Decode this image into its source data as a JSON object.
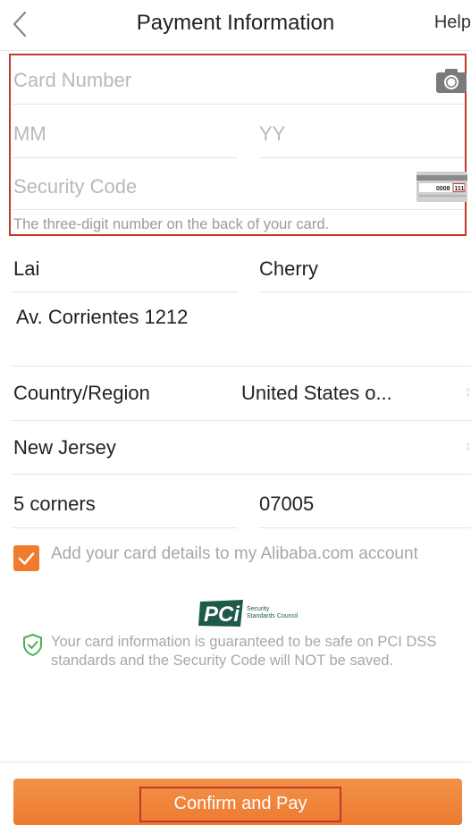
{
  "header": {
    "title": "Payment Information",
    "help_label": "Help"
  },
  "card": {
    "number_placeholder": "Card Number",
    "month_placeholder": "MM",
    "year_placeholder": "YY",
    "security_placeholder": "Security Code",
    "security_hint": "The three-digit number on the back of your card.",
    "card_image_number": "0008",
    "card_image_cvv": "111"
  },
  "billing": {
    "first_name": "Lai",
    "last_name": "Cherry",
    "address": "Av. Corrientes 1212",
    "country_label": "Country/Region",
    "country_value": "United States o...",
    "state": "New Jersey",
    "city": "5 corners",
    "zip": "07005"
  },
  "consent": {
    "checked": true,
    "text": "Add your card details to my Alibaba.com account"
  },
  "pci": {
    "logo_text": "PCi",
    "logo_caption_line1": "Security",
    "logo_caption_line2": "Standards Council",
    "notice": "Your card information is guaranteed to be safe on PCI DSS standards and the Security Code will NOT be saved."
  },
  "footer": {
    "pay_label": "Confirm and Pay"
  },
  "colors": {
    "accent": "#f07b2d",
    "highlight_border": "#c0392b",
    "shield_green": "#4caf50",
    "pci_green": "#1e5a4a"
  },
  "icons": [
    "back-chevron-icon",
    "camera-icon",
    "card-back-icon",
    "checkmark-icon",
    "shield-check-icon",
    "pci-logo"
  ]
}
